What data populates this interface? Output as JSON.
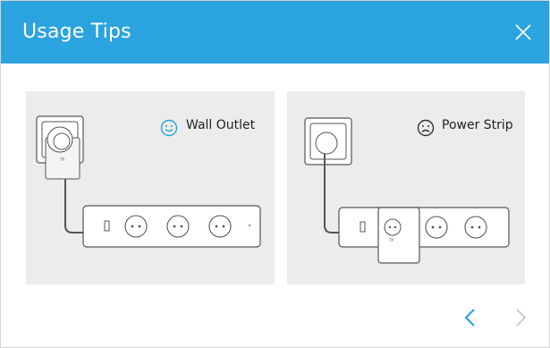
{
  "dialog": {
    "title": "Usage Tips",
    "accent_color": "#2ba3de",
    "close_icon": "close-icon"
  },
  "tips": [
    {
      "label": "Wall Outlet",
      "face_icon": "smiley-face-icon",
      "face_color": "#2ba3de",
      "recommended": true
    },
    {
      "label": "Power Strip",
      "face_icon": "sad-face-icon",
      "face_color": "#333333",
      "recommended": false
    }
  ],
  "navigation": {
    "prev_icon": "chevron-left-icon",
    "next_icon": "chevron-right-icon",
    "prev_color": "#2ba3de",
    "next_color": "#c8c8c8"
  }
}
